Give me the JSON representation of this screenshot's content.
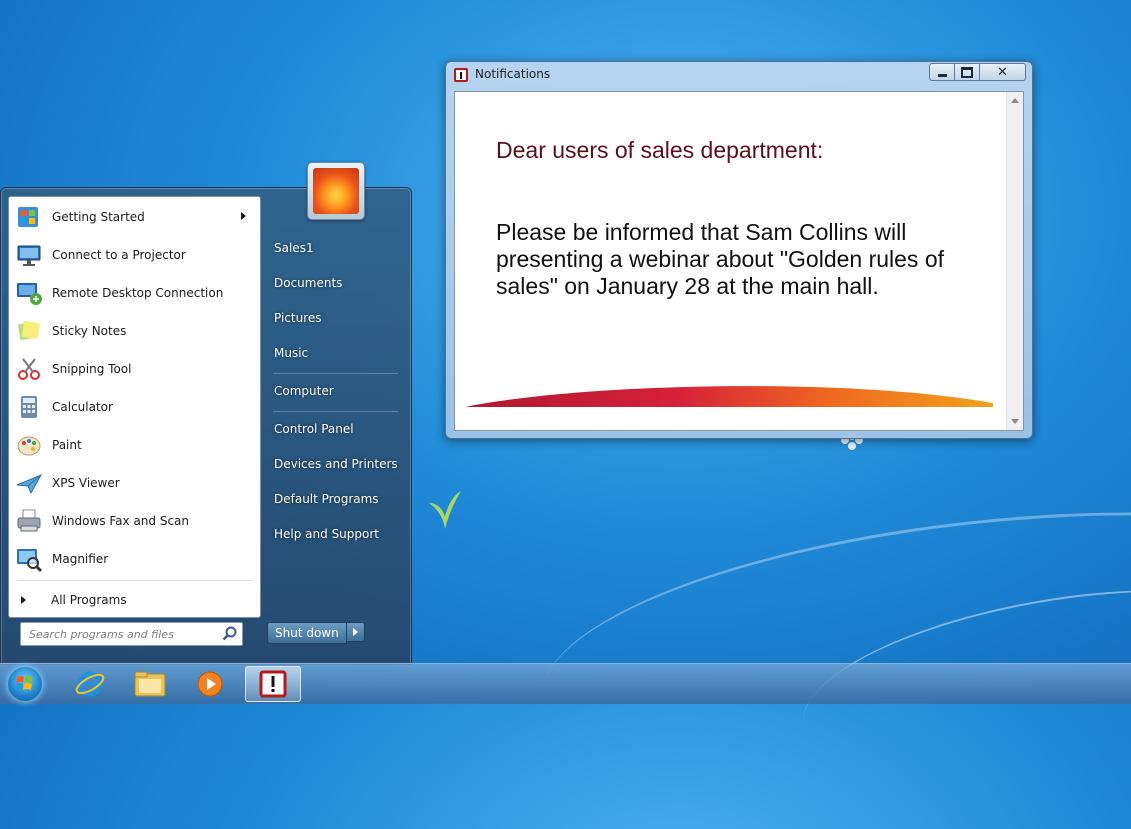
{
  "start_menu": {
    "programs": [
      {
        "label": "Getting Started",
        "icon": "getting-started-icon",
        "has_submenu": true
      },
      {
        "label": "Connect to a Projector",
        "icon": "projector-icon",
        "has_submenu": false
      },
      {
        "label": "Remote Desktop Connection",
        "icon": "remote-desktop-icon",
        "has_submenu": false
      },
      {
        "label": "Sticky Notes",
        "icon": "sticky-notes-icon",
        "has_submenu": false
      },
      {
        "label": "Snipping Tool",
        "icon": "snipping-tool-icon",
        "has_submenu": false
      },
      {
        "label": "Calculator",
        "icon": "calculator-icon",
        "has_submenu": false
      },
      {
        "label": "Paint",
        "icon": "paint-icon",
        "has_submenu": false
      },
      {
        "label": "XPS Viewer",
        "icon": "xps-viewer-icon",
        "has_submenu": false
      },
      {
        "label": "Windows Fax and Scan",
        "icon": "fax-scan-icon",
        "has_submenu": false
      },
      {
        "label": "Magnifier",
        "icon": "magnifier-icon",
        "has_submenu": false
      }
    ],
    "all_programs_label": "All Programs",
    "search_placeholder": "Search programs and files",
    "right_items": [
      {
        "label": "Sales1"
      },
      {
        "label": "Documents"
      },
      {
        "label": "Pictures"
      },
      {
        "label": "Music"
      },
      {
        "label": "Computer"
      },
      {
        "label": "Control Panel"
      },
      {
        "label": "Devices and Printers"
      },
      {
        "label": "Default Programs"
      },
      {
        "label": "Help and Support"
      }
    ],
    "shutdown_label": "Shut down"
  },
  "notification_window": {
    "title": "Notifications",
    "greeting": "Dear users of sales department:",
    "body": "Please be informed that Sam Collins will presenting a webinar about \"Golden rules of sales\" on January 28 at the main hall.",
    "accent_color": "#5b0f1c"
  },
  "taskbar": {
    "items": [
      {
        "icon": "internet-explorer-icon"
      },
      {
        "icon": "file-explorer-icon"
      },
      {
        "icon": "media-player-icon"
      },
      {
        "icon": "notifications-app-icon",
        "active": true
      }
    ]
  }
}
